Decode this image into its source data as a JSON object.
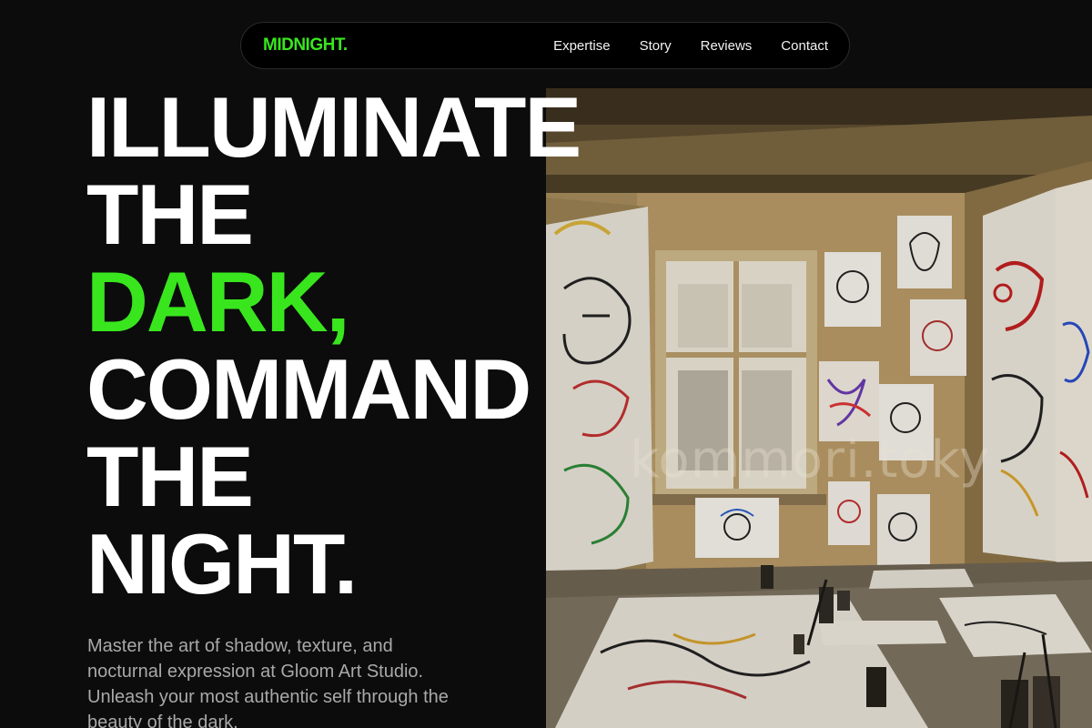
{
  "theme": {
    "background": "#0c0c0c",
    "accent": "#39e61e",
    "text": "#ffffff",
    "muted_text": "#a9a9a9"
  },
  "navbar": {
    "brand": "MIDNIGHT.",
    "links": [
      {
        "label": "Expertise",
        "icon": null
      },
      {
        "label": "Story",
        "icon": null
      },
      {
        "label": "Reviews",
        "icon": null
      },
      {
        "label": "Contact",
        "icon": null
      }
    ]
  },
  "hero": {
    "headline": {
      "line1": "ILLUMINATE",
      "line2": "THE",
      "line3_accent": "DARK,",
      "line4": "COMMAND",
      "line5": "THE",
      "line6": "NIGHT."
    },
    "description": "Master the art of shadow, texture, and nocturnal expression at Gloom Art Studio. Unleash your most authentic self through the beauty of the dark.",
    "image": {
      "subject": "art-studio-photo",
      "watermark": "kommori.toky"
    }
  }
}
